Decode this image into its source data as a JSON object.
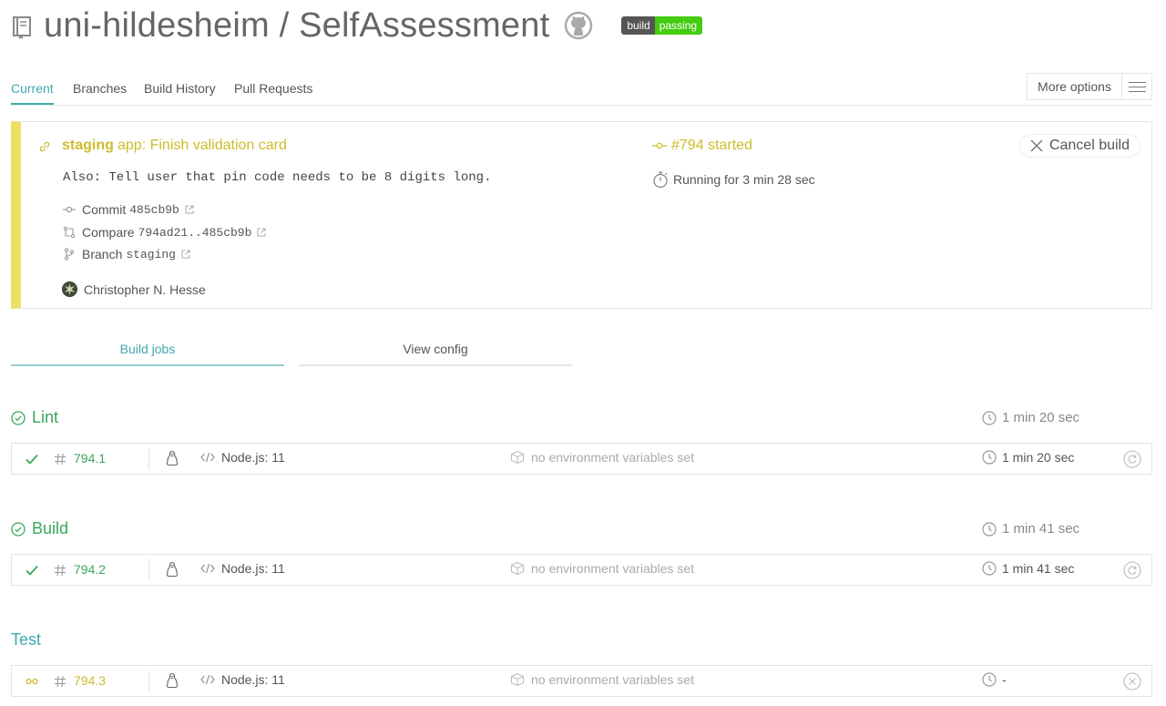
{
  "repo": {
    "owner": "uni-hildesheim",
    "name": "SelfAssessment",
    "title": "uni-hildesheim / SelfAssessment",
    "badge": {
      "left": "build",
      "right": "passing"
    }
  },
  "tabs": [
    {
      "label": "Current",
      "active": true
    },
    {
      "label": "Branches"
    },
    {
      "label": "Build History"
    },
    {
      "label": "Pull Requests"
    }
  ],
  "more_options": {
    "label": "More options"
  },
  "build": {
    "branch": "staging",
    "commit_title": "app: Finish validation card",
    "commit_body": "Also: Tell user that pin code needs to be 8 digits long.",
    "commit_label": "Commit",
    "commit_sha": "485cb9b",
    "compare_label": "Compare",
    "compare_range": "794ad21..485cb9b",
    "branch_label": "Branch",
    "branch_value": "staging",
    "author": "Christopher N. Hesse",
    "number_text": "#794 started",
    "running_text": "Running for 3 min 28 sec",
    "cancel_label": "Cancel build",
    "state_color": "#cdbc2c"
  },
  "sub_tabs": [
    {
      "label": "Build jobs",
      "active": true
    },
    {
      "label": "View config"
    }
  ],
  "stages": [
    {
      "name": "Lint",
      "status": "passed",
      "duration": "1 min 20 sec",
      "job": {
        "number": "794.1",
        "language": "Node.js: 11",
        "env": "no environment variables set",
        "duration": "1 min 20 sec",
        "status": "passed"
      }
    },
    {
      "name": "Build",
      "status": "passed",
      "duration": "1 min 41 sec",
      "job": {
        "number": "794.2",
        "language": "Node.js: 11",
        "env": "no environment variables set",
        "duration": "1 min 41 sec",
        "status": "passed"
      }
    },
    {
      "name": "Test",
      "status": "running",
      "duration": "",
      "job": {
        "number": "794.3",
        "language": "Node.js: 11",
        "env": "no environment variables set",
        "duration": "-",
        "status": "running"
      }
    }
  ],
  "colors": {
    "accent": "#3eaaaf",
    "passed": "#39a85b",
    "running": "#cdbc2c",
    "running_bar": "#ede060"
  }
}
